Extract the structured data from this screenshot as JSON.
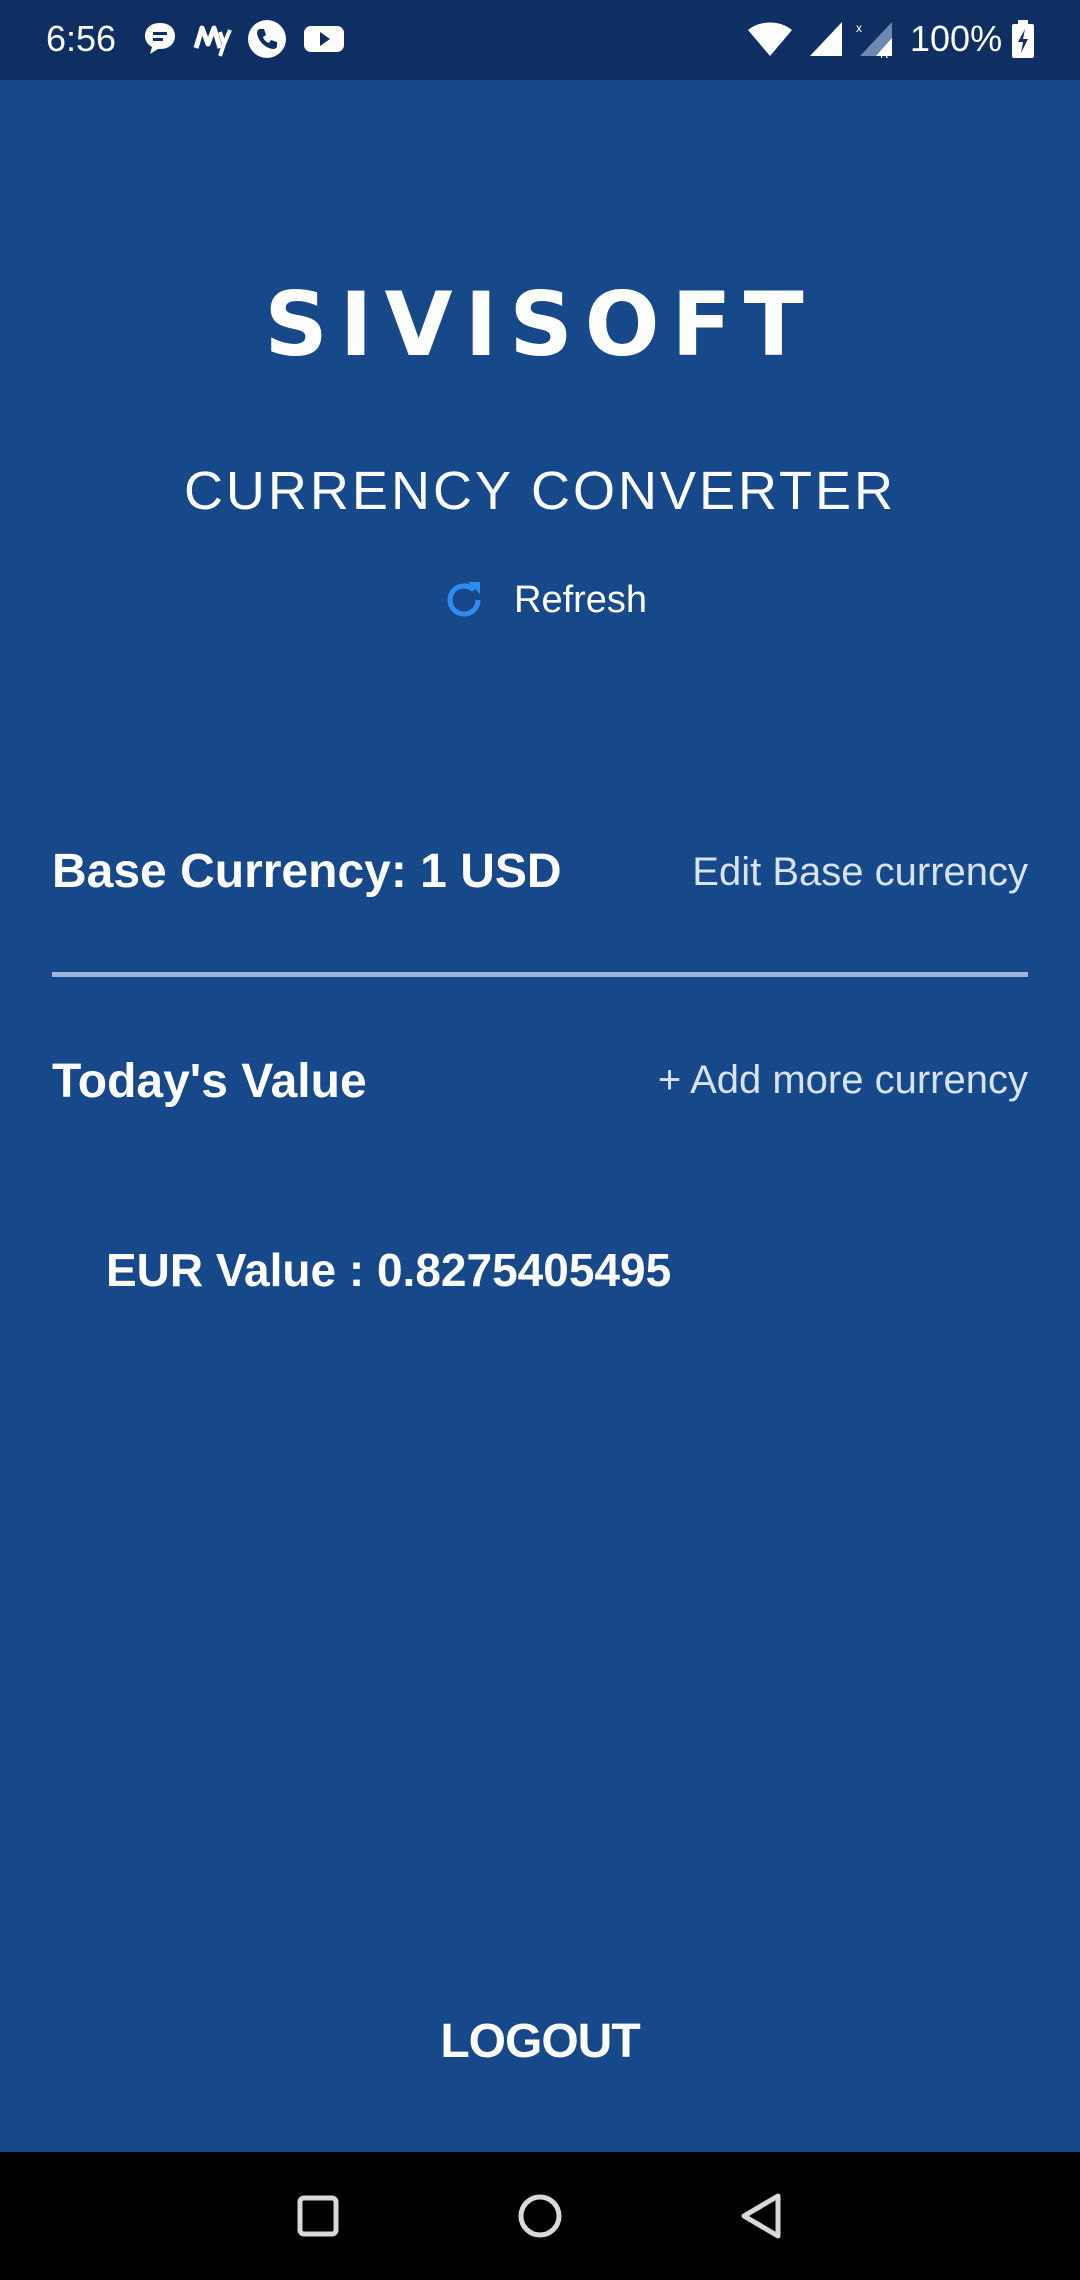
{
  "status_bar": {
    "time": "6:56",
    "battery": "100%",
    "icons": [
      "chat-icon",
      "myntra-icon",
      "phone-icon",
      "youtube-icon",
      "wifi-icon",
      "signal-icon",
      "signal-roaming-icon",
      "battery-charging-icon"
    ]
  },
  "app": {
    "brand": "SIVISOFT",
    "title": "CURRENCY CONVERTER",
    "refresh_label": "Refresh"
  },
  "base": {
    "label": "Base Currency: 1 USD",
    "edit_link": "Edit Base currency"
  },
  "today": {
    "label": "Today's Value",
    "add_link": "+ Add more currency"
  },
  "values": [
    {
      "text": "EUR Value : 0.8275405495"
    }
  ],
  "logout_label": "LOGOUT",
  "nav": {
    "buttons": [
      "recents-button",
      "home-button",
      "back-button"
    ]
  },
  "colors": {
    "background": "#16488a",
    "status_bar": "#0f2f63",
    "accent": "#2f8cf0",
    "divider": "#9cb4dc",
    "link": "#d7e2f3"
  }
}
